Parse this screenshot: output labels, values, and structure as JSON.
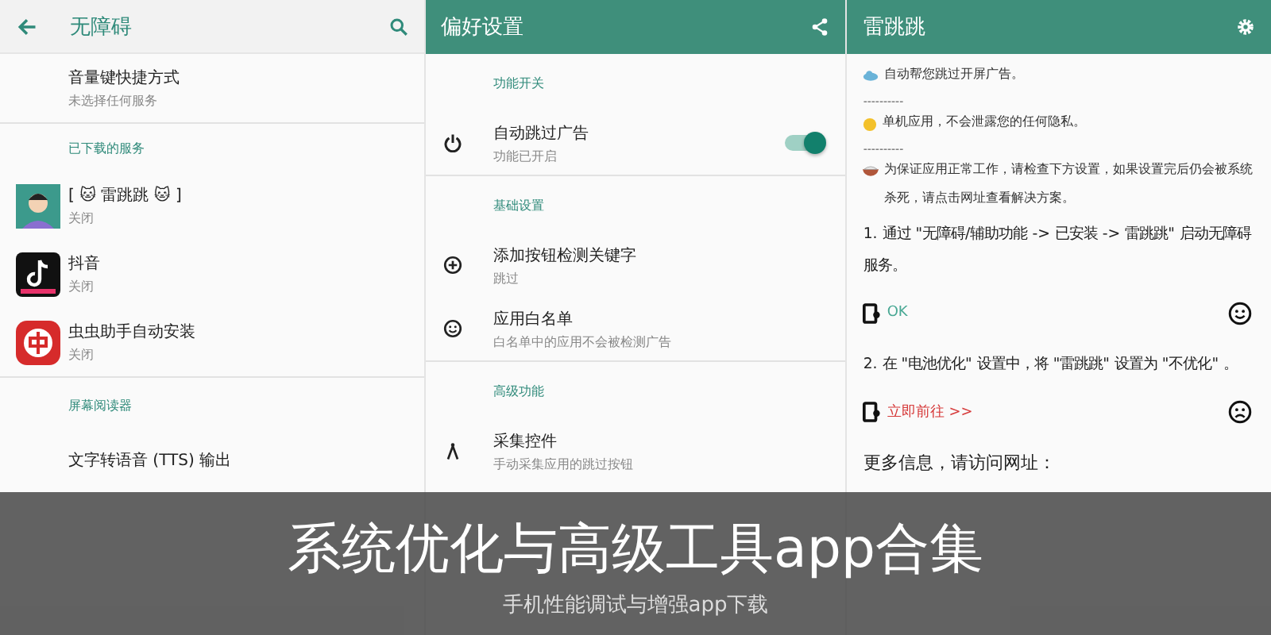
{
  "accessibility_screen": {
    "title": "无障碍",
    "shortcut": {
      "title": "音量键快捷方式",
      "subtitle": "未选择任何服务"
    },
    "sections": [
      {
        "header": "已下载的服务",
        "items": [
          {
            "kind": "avatar",
            "title": "[ 🐱 雷跳跳 🐱 ]",
            "subtitle": "关闭"
          },
          {
            "kind": "music",
            "title": "抖音",
            "subtitle": "关闭"
          },
          {
            "kind": "bug",
            "title": "虫虫助手自动安装",
            "subtitle": "关闭"
          }
        ]
      },
      {
        "header": "屏幕阅读器",
        "items": [
          {
            "kind": "text",
            "title": "文字转语音 (TTS) 输出"
          }
        ]
      }
    ]
  },
  "preferences_screen": {
    "title": "偏好设置",
    "sections": [
      {
        "header": "功能开关",
        "items": [
          {
            "kind": "switch",
            "on": true,
            "title": "自动跳过广告",
            "subtitle": "功能已开启"
          }
        ]
      },
      {
        "header": "基础设置",
        "items": [
          {
            "kind": "plain",
            "title": "添加按钮检测关键字",
            "subtitle": "跳过"
          },
          {
            "kind": "plain",
            "title": "应用白名单",
            "subtitle": "白名单中的应用不会被检测广告"
          }
        ]
      },
      {
        "header": "高级功能",
        "items": [
          {
            "kind": "plain",
            "title": "采集控件",
            "subtitle": "手动采集应用的跳过按钮"
          }
        ]
      }
    ]
  },
  "app_screen": {
    "title": "雷跳跳",
    "notes": [
      {
        "kind": "cloud",
        "text": "自动帮您跳过开屏广告。"
      },
      {
        "kind": "divider",
        "text": "----------"
      },
      {
        "kind": "sun",
        "text": "单机应用，不会泄露您的任何隐私。"
      },
      {
        "kind": "divider",
        "text": "----------"
      },
      {
        "kind": "bowl",
        "text": "为保证应用正常工作，请检查下方设置，如果设置完后仍会被系统杀死，请点击网址查看解决方案。"
      }
    ],
    "steps": [
      {
        "text": "1. 通过 \"无障碍/辅助功能 -> 已安装 -> 雷跳跳\" 启动无障碍服务。",
        "action": "OK",
        "ok": true
      },
      {
        "text": "2. 在 \"电池优化\" 设置中，将 \"雷跳跳\" 设置为 \"不优化\" 。",
        "action": "立即前往 >>",
        "ok": false
      }
    ],
    "more_info": "更多信息，请访问网址："
  },
  "banner": {
    "title": "系统优化与高级工具app合集",
    "subtitle": "手机性能调试与增强app下载"
  }
}
